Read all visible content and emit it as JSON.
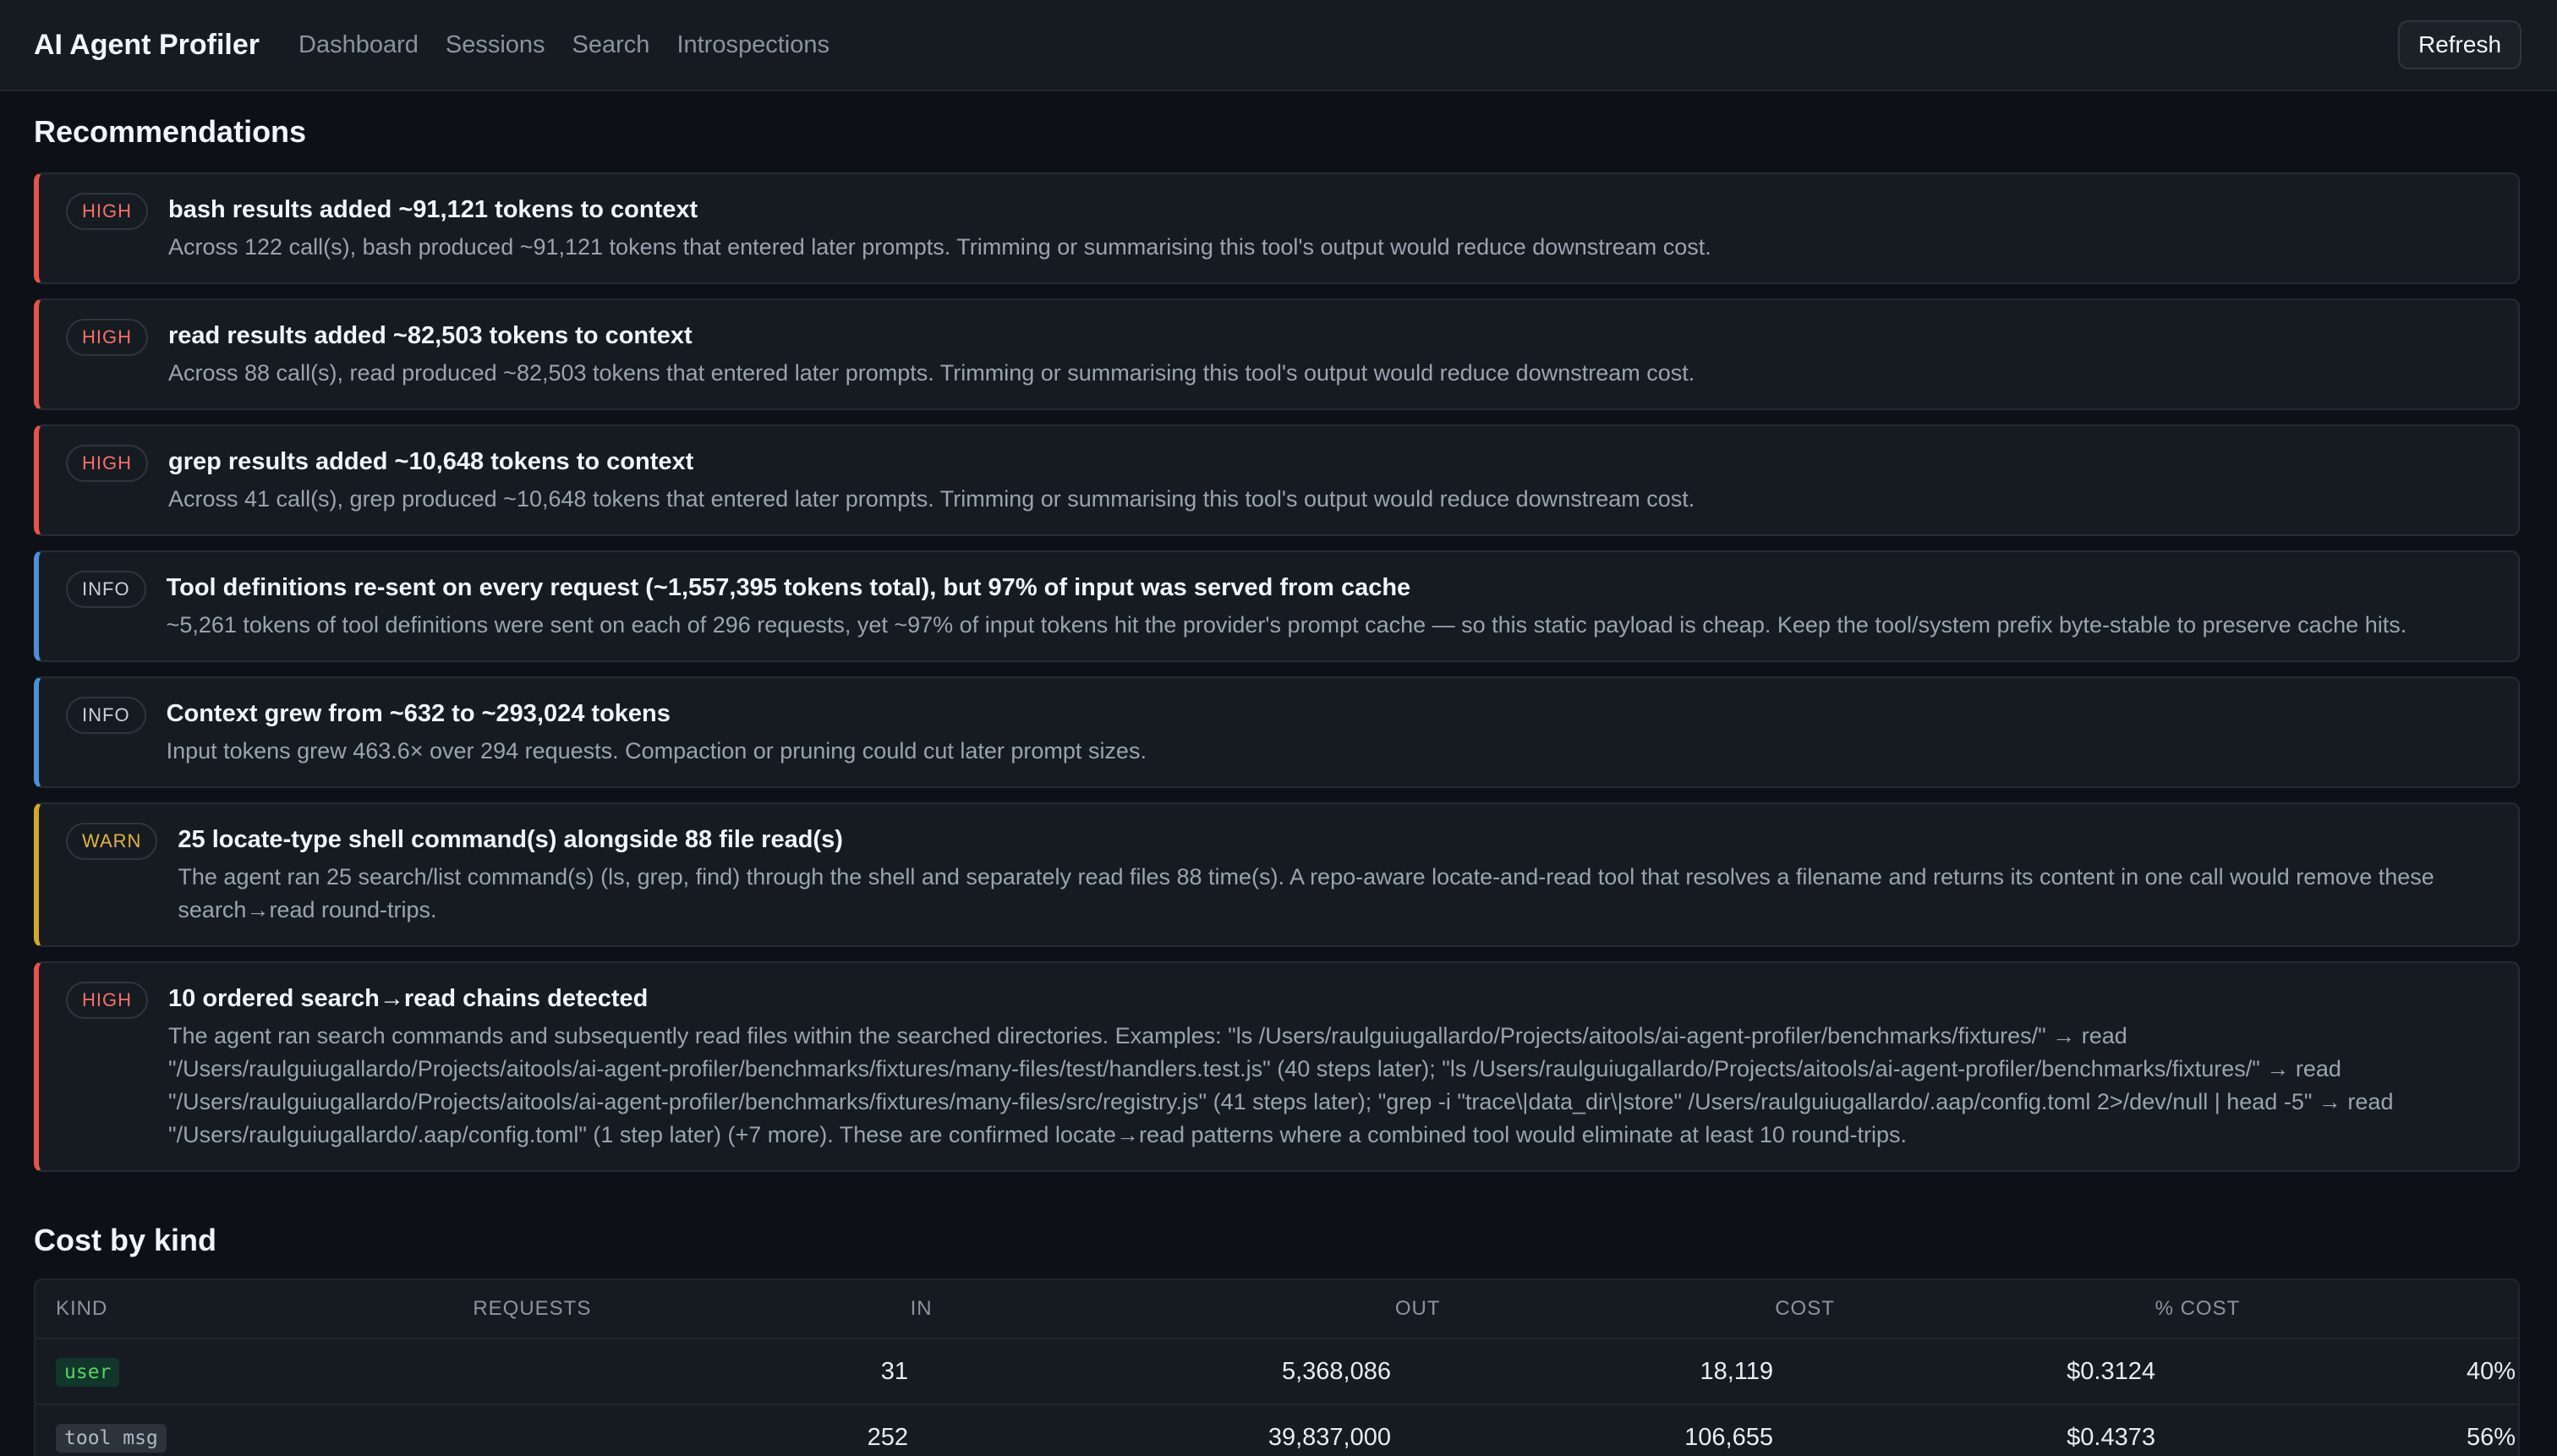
{
  "header": {
    "brand": "AI Agent Profiler",
    "nav": [
      "Dashboard",
      "Sessions",
      "Search",
      "Introspections"
    ],
    "refresh_label": "Refresh"
  },
  "recommendations": {
    "title": "Recommendations",
    "items": [
      {
        "severity": "high",
        "badge": "HIGH",
        "title": "bash results added ~91,121 tokens to context",
        "text": "Across 122 call(s), bash produced ~91,121 tokens that entered later prompts. Trimming or summarising this tool's output would reduce downstream cost."
      },
      {
        "severity": "high",
        "badge": "HIGH",
        "title": "read results added ~82,503 tokens to context",
        "text": "Across 88 call(s), read produced ~82,503 tokens that entered later prompts. Trimming or summarising this tool's output would reduce downstream cost."
      },
      {
        "severity": "high",
        "badge": "HIGH",
        "title": "grep results added ~10,648 tokens to context",
        "text": "Across 41 call(s), grep produced ~10,648 tokens that entered later prompts. Trimming or summarising this tool's output would reduce downstream cost."
      },
      {
        "severity": "info",
        "badge": "INFO",
        "title": "Tool definitions re-sent on every request (~1,557,395 tokens total), but 97% of input was served from cache",
        "text": "~5,261 tokens of tool definitions were sent on each of 296 requests, yet ~97% of input tokens hit the provider's prompt cache — so this static payload is cheap. Keep the tool/system prefix byte-stable to preserve cache hits."
      },
      {
        "severity": "info",
        "badge": "INFO",
        "title": "Context grew from ~632 to ~293,024 tokens",
        "text": "Input tokens grew 463.6× over 294 requests. Compaction or pruning could cut later prompt sizes."
      },
      {
        "severity": "warn",
        "badge": "WARN",
        "title": "25 locate-type shell command(s) alongside 88 file read(s)",
        "text": "The agent ran 25 search/list command(s) (ls, grep, find) through the shell and separately read files 88 time(s). A repo-aware locate-and-read tool that resolves a filename and returns its content in one call would remove these search→read round-trips."
      },
      {
        "severity": "high",
        "badge": "HIGH",
        "title": "10 ordered search→read chains detected",
        "text": "The agent ran search commands and subsequently read files within the searched directories. Examples: \"ls /Users/raulguiugallardo/Projects/aitools/ai-agent-profiler/benchmarks/fixtures/\" → read \"/Users/raulguiugallardo/Projects/aitools/ai-agent-profiler/benchmarks/fixtures/many-files/test/handlers.test.js\" (40 steps later); \"ls /Users/raulguiugallardo/Projects/aitools/ai-agent-profiler/benchmarks/fixtures/\" → read \"/Users/raulguiugallardo/Projects/aitools/ai-agent-profiler/benchmarks/fixtures/many-files/src/registry.js\" (41 steps later); \"grep -i \"trace\\|data_dir\\|store\" /Users/raulguiugallardo/.aap/config.toml 2>/dev/null | head -5\" → read \"/Users/raulguiugallardo/.aap/config.toml\" (1 step later) (+7 more). These are confirmed locate→read patterns where a combined tool would eliminate at least 10 round-trips."
      }
    ]
  },
  "cost_by_kind": {
    "title": "Cost by kind",
    "columns": [
      "KIND",
      "REQUESTS",
      "IN",
      "OUT",
      "COST",
      "% COST"
    ],
    "rows": [
      {
        "kind": "user",
        "requests": "31",
        "in": "5,368,086",
        "out": "18,119",
        "cost": "$0.3124",
        "pct": "40%"
      },
      {
        "kind": "tool msg",
        "requests": "252",
        "in": "39,837,000",
        "out": "106,655",
        "cost": "$0.4373",
        "pct": "56%"
      }
    ]
  }
}
